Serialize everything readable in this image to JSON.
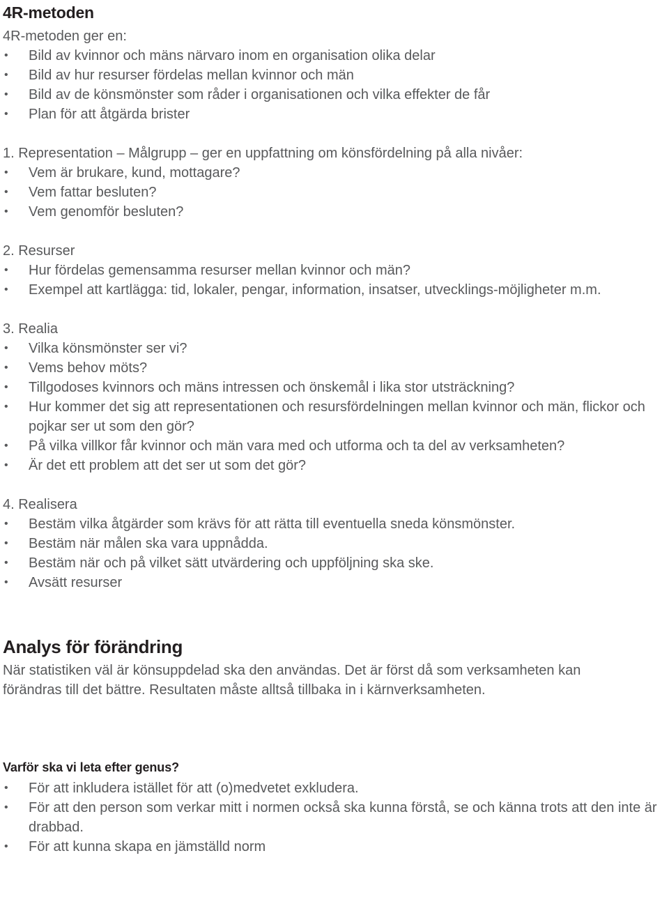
{
  "document": {
    "title": "4R-metoden",
    "text_color": "#58595b",
    "heading_color": "#231f20"
  },
  "intro": {
    "title": "4R-metoden",
    "lead": "4R-metoden ger en:",
    "bullets": [
      "Bild av kvinnor och mäns närvaro inom en organisation olika delar",
      "Bild av hur resurser fördelas mellan kvinnor och män",
      "Bild av de könsmönster som råder i organisationen och vilka effekter de får",
      "Plan för att åtgärda brister"
    ]
  },
  "steps": [
    {
      "heading": "1. Representation – Målgrupp – ger en uppfattning om könsfördelning på alla nivåer:",
      "bullets": [
        "Vem är brukare, kund, mottagare?",
        "Vem fattar besluten?",
        "Vem genomför besluten?"
      ]
    },
    {
      "heading": "2. Resurser",
      "bullets": [
        "Hur fördelas gemensamma resurser mellan kvinnor och män?",
        "Exempel att kartlägga: tid, lokaler, pengar, information, insatser, utvecklings-möjligheter m.m."
      ]
    },
    {
      "heading": "3. Realia",
      "bullets": [
        "Vilka könsmönster ser vi?",
        "Vems behov möts?",
        "Tillgodoses kvinnors och mäns intressen och önskemål i lika stor utsträckning?",
        "Hur kommer det sig att representationen och resursfördelningen mellan kvinnor och män, flickor och pojkar ser ut som den gör?",
        "På vilka villkor får kvinnor och män vara med och utforma och ta del av verksamheten?",
        "Är det ett problem att det ser ut som det gör?"
      ]
    },
    {
      "heading": "4. Realisera",
      "bullets": [
        "Bestäm vilka åtgärder som krävs för att rätta till eventuella sneda könsmönster.",
        "Bestäm när målen ska vara uppnådda.",
        "Bestäm när och på vilket sätt utvärdering och uppföljning ska ske.",
        "Avsätt resurser"
      ]
    }
  ],
  "analysis": {
    "heading": "Analys för förändring",
    "paragraph": "När statistiken väl är könsuppdelad ska den användas. Det är först då som verksamheten kan förändras till det bättre. Resultaten måste alltså tillbaka in i kärnverksamheten."
  },
  "genus": {
    "heading": "Varför ska vi leta efter genus?",
    "bullets": [
      "För att inkludera istället för att (o)medvetet exkludera.",
      "För att den person som verkar mitt i normen också ska kunna förstå, se och känna trots att den inte är drabbad.",
      "För att kunna skapa en jämställd norm"
    ]
  },
  "bullet_glyph": "•"
}
